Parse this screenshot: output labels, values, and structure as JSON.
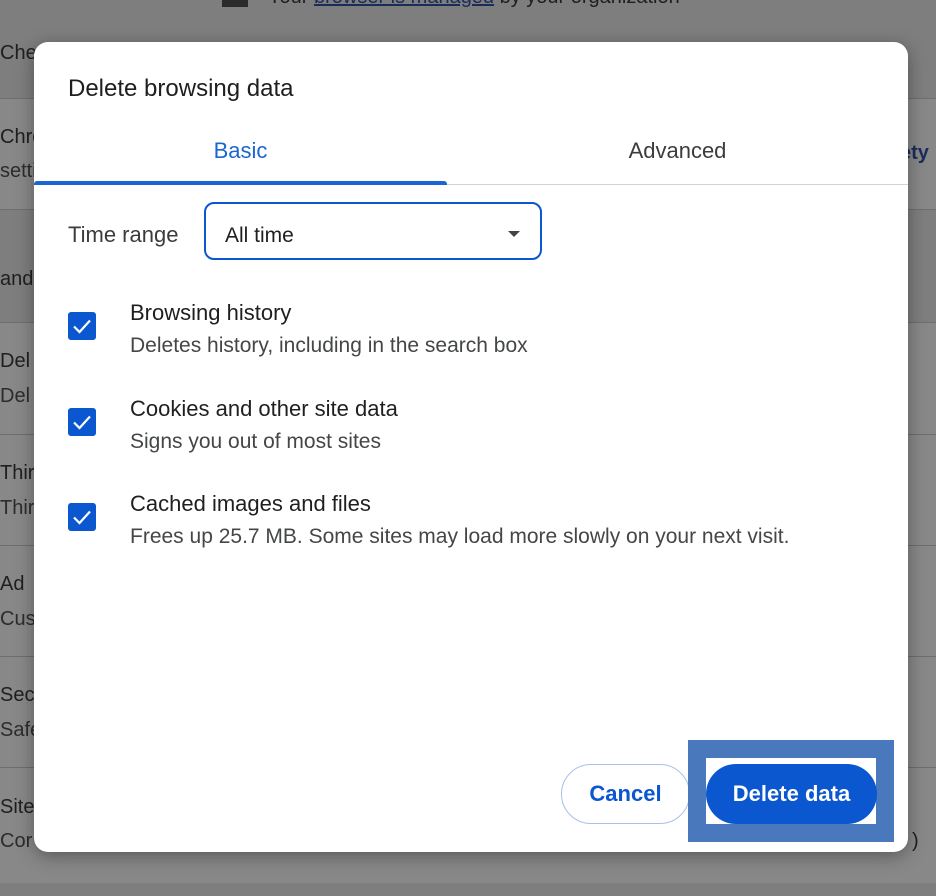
{
  "background": {
    "managed_prefix": "Your ",
    "managed_link": "browser is managed",
    "managed_suffix": " by your organization",
    "fragments": {
      "check": "Chec",
      "chrome": "Chro",
      "settings": "setti",
      "safety": "ety",
      "and": "and",
      "del_title": "Del",
      "del_sub": "Del",
      "third_title": "Thir",
      "third_sub": "Thir",
      "ad_title": "Ad",
      "ad_sub": "Cus",
      "sec_title": "Sec",
      "sec_sub": "Safe",
      "site_title": "Site",
      "site_sub": "Cor",
      "paren": ")"
    }
  },
  "dialog": {
    "title": "Delete browsing data",
    "tabs": [
      {
        "label": "Basic",
        "selected": true
      },
      {
        "label": "Advanced",
        "selected": false
      }
    ],
    "time_range": {
      "label": "Time range",
      "value": "All time"
    },
    "options": [
      {
        "title": "Browsing history",
        "subtitle": "Deletes history, including in the search box",
        "checked": true
      },
      {
        "title": "Cookies and other site data",
        "subtitle": "Signs you out of most sites",
        "checked": true
      },
      {
        "title": "Cached images and files",
        "subtitle": "Frees up 25.7 MB. Some sites may load more slowly on your next visit.",
        "checked": true
      }
    ],
    "buttons": {
      "cancel": "Cancel",
      "delete": "Delete data"
    }
  },
  "colors": {
    "accent": "#0b57d0",
    "tab_selected": "#1a66d2",
    "highlight_frame": "#4a78bd"
  }
}
